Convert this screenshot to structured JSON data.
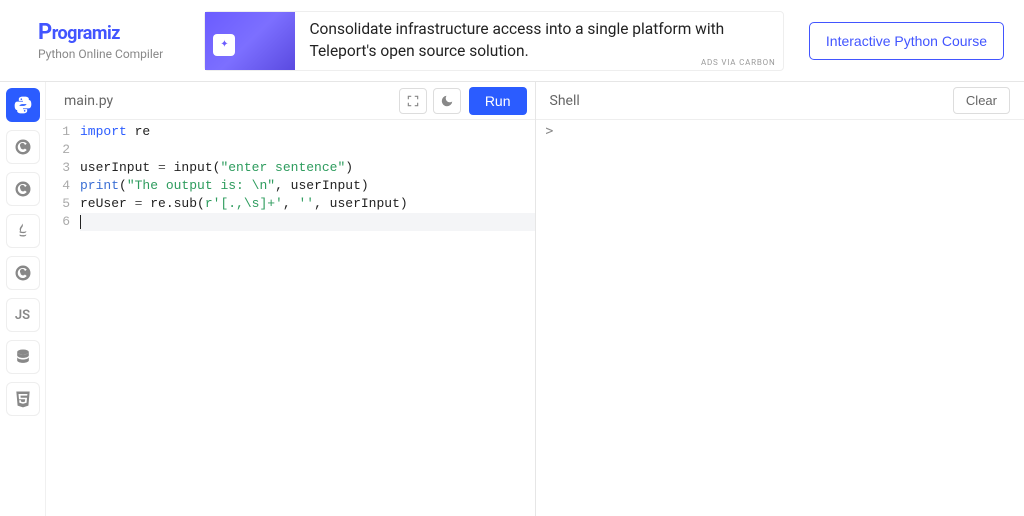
{
  "brand": {
    "name": "Programiz",
    "subtitle": "Python Online Compiler"
  },
  "ad": {
    "text": "Consolidate infrastructure access into a single platform with Teleport's open source solution.",
    "via": "ADS VIA CARBON",
    "badge": "Teleport"
  },
  "cta": {
    "course": "Interactive Python Course"
  },
  "sidebar": {
    "items": [
      {
        "name": "python",
        "label": "Py",
        "active": true
      },
      {
        "name": "c",
        "label": "C",
        "active": false
      },
      {
        "name": "cpp",
        "label": "C",
        "active": false
      },
      {
        "name": "java",
        "label": "J",
        "active": false
      },
      {
        "name": "csharp",
        "label": "C",
        "active": false
      },
      {
        "name": "js",
        "label": "JS",
        "active": false
      },
      {
        "name": "sql",
        "label": "DB",
        "active": false
      },
      {
        "name": "html",
        "label": "H",
        "active": false
      }
    ]
  },
  "editor": {
    "tab": "main.py",
    "run": "Run",
    "lines": [
      {
        "n": "1"
      },
      {
        "n": "2"
      },
      {
        "n": "3"
      },
      {
        "n": "4"
      },
      {
        "n": "5"
      },
      {
        "n": "6"
      }
    ],
    "code": {
      "l1": {
        "kw": "import",
        "id": " re"
      },
      "l2": "",
      "l3": {
        "a": "userInput ",
        "op": "=",
        "b": " input(",
        "str": "\"enter sentence\"",
        "c": ")"
      },
      "l4": {
        "fn": "print",
        "a": "(",
        "str": "\"The output is: \\n\"",
        "b": ", userInput)"
      },
      "l5": {
        "a": "reUser ",
        "op": "=",
        "b": " re.sub(",
        "str1": "r'[.,\\s]+'",
        "c": ", ",
        "str2": "''",
        "d": ", userInput)"
      }
    }
  },
  "shell": {
    "label": "Shell",
    "clear": "Clear",
    "prompt": ">"
  }
}
